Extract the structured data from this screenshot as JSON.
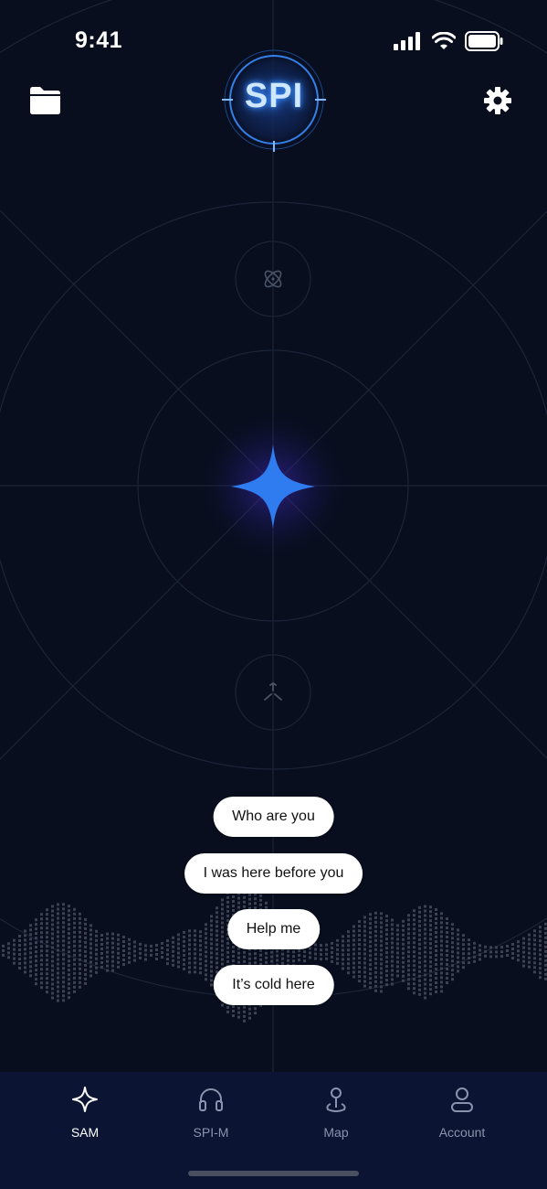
{
  "status": {
    "time": "9:41"
  },
  "header": {
    "logo_text": "SPI",
    "left_icon": "folder-icon",
    "right_icon": "gear-icon"
  },
  "orbit": {
    "center_icon": "sparkle-icon",
    "top_icon": "atom-icon",
    "bottom_icon": "tri-blades-icon"
  },
  "suggestions": [
    {
      "label": "Who are you"
    },
    {
      "label": "I was here before you"
    },
    {
      "label": "Help me"
    },
    {
      "label": "It’s cold here"
    }
  ],
  "tabs": [
    {
      "label": "SAM",
      "icon": "sparkle-outline-icon",
      "active": true
    },
    {
      "label": "SPI-M",
      "icon": "headphones-icon",
      "active": false
    },
    {
      "label": "Map",
      "icon": "map-pin-icon",
      "active": false
    },
    {
      "label": "Account",
      "icon": "user-icon",
      "active": false
    }
  ],
  "colors": {
    "background": "#080e1e",
    "accent": "#2f7bf0",
    "tabbar": "#0b1533"
  }
}
